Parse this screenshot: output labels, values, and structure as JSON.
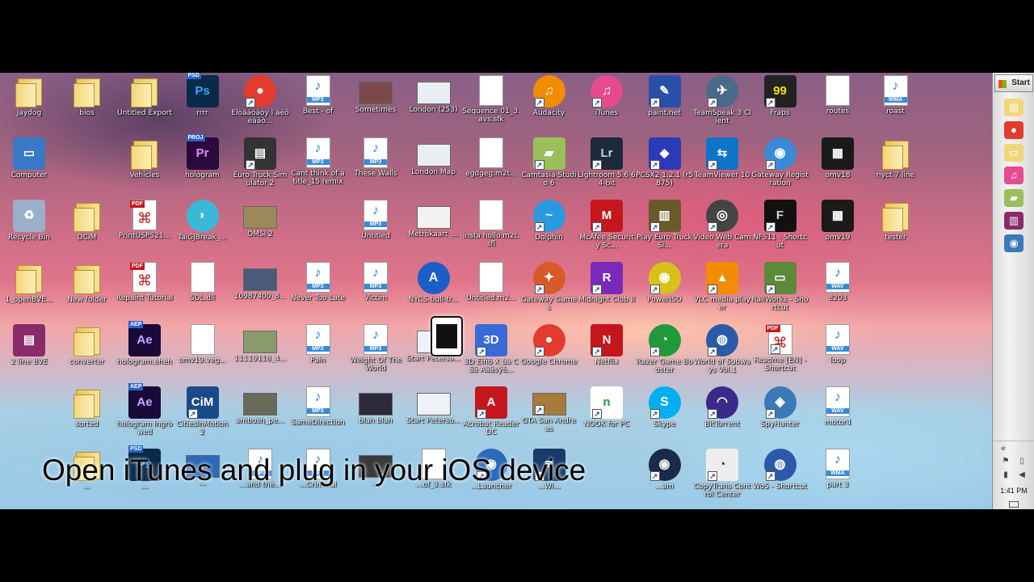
{
  "desktop": {
    "icons": [
      {
        "label": "Jaydog",
        "kind": "user",
        "color": "#e8c55a"
      },
      {
        "label": "bios",
        "kind": "folder"
      },
      {
        "label": "Untitled Export",
        "kind": "folder"
      },
      {
        "label": "rrrr",
        "kind": "app",
        "badge": "PSD",
        "text": "Ps",
        "color": "#0a2a4a",
        "fg": "#31a8ff"
      },
      {
        "label": "Élòåáòàòy l àéöeáäò...",
        "kind": "round",
        "text": "●",
        "color": "#e33b2e",
        "shortcut": true
      },
      {
        "label": "Best - of",
        "kind": "audio",
        "fmt": "MP3"
      },
      {
        "label": "Sometimes",
        "kind": "pic",
        "color": "#7a4a4a"
      },
      {
        "label": "London (253)",
        "kind": "pic",
        "color": "#e9eef3"
      },
      {
        "label": "Sequence 01_3.avs.sfk",
        "kind": "doc"
      },
      {
        "label": "Audacity",
        "kind": "round",
        "text": "♫",
        "color": "#f28c00",
        "shortcut": true
      },
      {
        "label": "iTunes",
        "kind": "round",
        "text": "♫",
        "color": "#e84a8f",
        "shortcut": true
      },
      {
        "label": "paint.net",
        "kind": "app",
        "text": "✎",
        "color": "#2a4fa8",
        "shortcut": true
      },
      {
        "label": "TeamSpeak 3 Client",
        "kind": "round",
        "text": "✈",
        "color": "#4a6a8a",
        "shortcut": true
      },
      {
        "label": "Fraps",
        "kind": "app",
        "text": "99",
        "color": "#222",
        "fg": "#f5e100",
        "shortcut": true
      },
      {
        "label": "routes",
        "kind": "doc"
      },
      {
        "label": "roast",
        "kind": "audio",
        "fmt": "WMA"
      },
      {
        "label": "Computer",
        "kind": "app",
        "text": "▭",
        "color": "#3a78c8"
      },
      {
        "label": "Vehicles",
        "kind": "folder"
      },
      {
        "label": "hologram",
        "kind": "app",
        "badge": "PROJ",
        "text": "Pr",
        "color": "#2a0a3a",
        "fg": "#e58bff"
      },
      {
        "label": "Euro Truck Simulator 2",
        "kind": "app",
        "text": "▤",
        "color": "#333",
        "shortcut": true
      },
      {
        "label": "Cant think of a title_15 remix",
        "kind": "audio",
        "fmt": "MP3"
      },
      {
        "label": "These Walls",
        "kind": "audio",
        "fmt": "MP3"
      },
      {
        "label": "London Map",
        "kind": "pic",
        "color": "#e9eef3"
      },
      {
        "label": "egdgeg.m2t...",
        "kind": "doc"
      },
      {
        "label": "Camtasia Studio 6",
        "kind": "app",
        "text": "▰",
        "color": "#9bbf5a",
        "shortcut": true
      },
      {
        "label": "Lightroom 5.6 64-bit",
        "kind": "app",
        "text": "Lr",
        "color": "#1c2a3a",
        "fg": "#b9d6f2",
        "shortcut": true
      },
      {
        "label": "PCSX2 1.2.1 (r5875)",
        "kind": "app",
        "text": "◆",
        "color": "#2a3ab8",
        "shortcut": true
      },
      {
        "label": "TeamViewer 10",
        "kind": "app",
        "text": "⇆",
        "color": "#0e74c8",
        "shortcut": true
      },
      {
        "label": "Gateway Registration",
        "kind": "round",
        "text": "◉",
        "color": "#3a8ad8",
        "shortcut": true
      },
      {
        "label": "omv18",
        "kind": "app",
        "text": "▦",
        "color": "#1a1a1a"
      },
      {
        "label": "nyct 7 line",
        "kind": "folder"
      },
      {
        "label": "Recycle Bin",
        "kind": "app",
        "text": "♻",
        "color": "#9ab0c8"
      },
      {
        "label": "DCIM",
        "kind": "folder"
      },
      {
        "label": "PrintUSPS21...",
        "kind": "pdf"
      },
      {
        "label": "TaiGJBreak_...",
        "kind": "round",
        "text": "◗",
        "color": "#3ab8d8"
      },
      {
        "label": "OMSI 2",
        "kind": "pic",
        "color": "#9a8a5a"
      },
      {
        "label": "Untitled",
        "kind": "audio",
        "fmt": "MP3"
      },
      {
        "label": "Metrokaart_...",
        "kind": "pic",
        "color": "#f2f2f2"
      },
      {
        "label": "insta hollo.m2t.sfl",
        "kind": "doc"
      },
      {
        "label": "Dolphin",
        "kind": "round",
        "text": "~",
        "color": "#2a9ae0",
        "shortcut": true
      },
      {
        "label": "McAfee Security Sc...",
        "kind": "app",
        "text": "M",
        "color": "#c4161c",
        "shortcut": true
      },
      {
        "label": "Play Euro Truck Si...",
        "kind": "app",
        "text": "▥",
        "color": "#6a5a2a",
        "shortcut": true
      },
      {
        "label": "Video Web Camera",
        "kind": "round",
        "text": "◎",
        "color": "#444",
        "shortcut": true
      },
      {
        "label": "NFS11 - Shortcut",
        "kind": "app",
        "text": "F",
        "color": "#111",
        "fg": "#d8d8d8",
        "shortcut": true
      },
      {
        "label": "omv19",
        "kind": "app",
        "text": "▦",
        "color": "#1a1a1a"
      },
      {
        "label": "tester",
        "kind": "folder"
      },
      {
        "label": "1_openBVE...",
        "kind": "folder"
      },
      {
        "label": "New folder",
        "kind": "folder"
      },
      {
        "label": "Repaint Tutorial",
        "kind": "pdf"
      },
      {
        "label": "SDL.dll",
        "kind": "doc"
      },
      {
        "label": "10987400_8...",
        "kind": "pic",
        "color": "#4a5a7a"
      },
      {
        "label": "Never Too Late",
        "kind": "audio",
        "fmt": "MP3"
      },
      {
        "label": "Victim",
        "kind": "audio",
        "fmt": "MP3"
      },
      {
        "label": "NYCS-bull-tr...",
        "kind": "round",
        "text": "A",
        "color": "#1a5fc8"
      },
      {
        "label": "Untitled.m2...",
        "kind": "doc"
      },
      {
        "label": "Gateway Games",
        "kind": "round",
        "text": "✦",
        "color": "#d85a2a",
        "shortcut": true
      },
      {
        "label": "Midnight Club II",
        "kind": "app",
        "text": "R",
        "color": "#7a2ab8",
        "shortcut": true
      },
      {
        "label": "PowerISO",
        "kind": "round",
        "text": "◉",
        "color": "#d8c21a",
        "shortcut": true
      },
      {
        "label": "VLC media player",
        "kind": "app",
        "text": "▲",
        "color": "#f28c00",
        "shortcut": true
      },
      {
        "label": "RailWorks - Shortcut",
        "kind": "app",
        "text": "▭",
        "color": "#5a8a3a",
        "shortcut": true
      },
      {
        "label": "8203",
        "kind": "audio",
        "fmt": "WAV"
      },
      {
        "label": "2 line BVE",
        "kind": "app",
        "text": "▤",
        "color": "#8a2a6a"
      },
      {
        "label": "converter",
        "kind": "folder"
      },
      {
        "label": "hologram.eheh",
        "kind": "app",
        "badge": "AEP",
        "text": "Ae",
        "color": "#1a0a3a",
        "fg": "#c9a7ff"
      },
      {
        "label": "omv19.veg...",
        "kind": "doc"
      },
      {
        "label": "11119118_4...",
        "kind": "pic",
        "color": "#8a9a6a"
      },
      {
        "label": "Pain",
        "kind": "audio",
        "fmt": "MP3"
      },
      {
        "label": "Weight Of The World",
        "kind": "audio",
        "fmt": "MP3"
      },
      {
        "label": "Start Peterso...",
        "kind": "pic",
        "color": "#eef2f6"
      },
      {
        "label": "3D Éiñõ X ùà Cãã Aàäsýõ...",
        "kind": "app",
        "text": "3D",
        "color": "#3a6ad8",
        "shortcut": true
      },
      {
        "label": "Google Chrome",
        "kind": "round",
        "text": "●",
        "color": "#e33b2e",
        "shortcut": true
      },
      {
        "label": "Netflix",
        "kind": "app",
        "text": "N",
        "color": "#c4161c",
        "shortcut": true
      },
      {
        "label": "Razer Game Booster",
        "kind": "round",
        "text": "◔",
        "color": "#1f9a3a",
        "shortcut": true
      },
      {
        "label": "World of Subways Vol.1",
        "kind": "round",
        "text": "◍",
        "color": "#2a5aa8",
        "shortcut": true
      },
      {
        "label": "Readme [EN] - Shortcut",
        "kind": "pdf",
        "shortcut": true
      },
      {
        "label": "loop",
        "kind": "audio",
        "fmt": "WAV"
      },
      {
        "label": "sorted",
        "kind": "folder"
      },
      {
        "label": "hologram ingrowed",
        "kind": "app",
        "badge": "AEP",
        "text": "Ae",
        "color": "#1a0a3a",
        "fg": "#c9a7ff"
      },
      {
        "label": "CitiesInMotion 2",
        "kind": "app",
        "text": "CiM",
        "color": "#1a4a8a",
        "shortcut": true
      },
      {
        "label": "ambush_pe...",
        "kind": "pic",
        "color": "#6a6a5a"
      },
      {
        "label": "SameDirection",
        "kind": "audio",
        "fmt": "MP3"
      },
      {
        "label": "blah blah",
        "kind": "pic",
        "color": "#2a2a3a"
      },
      {
        "label": "Start Peterso...",
        "kind": "pic",
        "color": "#eef2f6"
      },
      {
        "label": "Acrobat Reader DC",
        "kind": "app",
        "text": "A",
        "color": "#c4161c",
        "shortcut": true
      },
      {
        "label": "GTA San Andreas",
        "kind": "pic",
        "color": "#a87a3a",
        "shortcut": true
      },
      {
        "label": "NOOK for PC",
        "kind": "app",
        "text": "n",
        "color": "#fff",
        "fg": "#1a9a5a",
        "shortcut": true
      },
      {
        "label": "Skype",
        "kind": "round",
        "text": "S",
        "color": "#00aff0",
        "shortcut": true
      },
      {
        "label": "BitTorrent",
        "kind": "round",
        "text": "◠",
        "color": "#3a2a8a",
        "shortcut": true
      },
      {
        "label": "SpyHunter",
        "kind": "round",
        "text": "◈",
        "color": "#3a7ab8",
        "shortcut": true
      },
      {
        "label": "motor4",
        "kind": "audio",
        "fmt": "WAV"
      },
      {
        "label": "...",
        "kind": "folder"
      },
      {
        "label": "...",
        "kind": "app",
        "badge": "PSD",
        "text": "Ps",
        "color": "#0a2a4a",
        "fg": "#31a8ff"
      },
      {
        "label": "...",
        "kind": "pic",
        "color": "#2a6ab8"
      },
      {
        "label": "...and the...",
        "kind": "audio",
        "fmt": "MP3"
      },
      {
        "label": "...Criminal",
        "kind": "audio",
        "fmt": "MP3"
      },
      {
        "label": "...",
        "kind": "pic",
        "color": "#3a3a3a"
      },
      {
        "label": "...of_3.sfk",
        "kind": "doc"
      },
      {
        "label": "...Launcher",
        "kind": "round",
        "text": "◉",
        "color": "#2a6ab8",
        "shortcut": true
      },
      {
        "label": "...Wi...",
        "kind": "app",
        "text": "≋",
        "color": "#1a3a6a",
        "shortcut": true
      },
      {
        "label": "...am",
        "kind": "round",
        "text": "◉",
        "color": "#1a2a4a",
        "shortcut": true
      },
      {
        "label": "CopyTrans Control Center",
        "kind": "app",
        "text": "◔",
        "color": "#eee",
        "fg": "#333",
        "shortcut": true
      },
      {
        "label": "WoS - Shortcut",
        "kind": "round",
        "text": "◍",
        "color": "#2a5aa8",
        "shortcut": true
      },
      {
        "label": "part 3",
        "kind": "audio",
        "fmt": "WMA"
      }
    ]
  },
  "taskbar": {
    "start_label": "Start",
    "pinned": [
      {
        "name": "explorer-taskbar-icon",
        "symbol": "▤",
        "color": "#f2d77a"
      },
      {
        "name": "chrome-taskbar-icon",
        "symbol": "●",
        "color": "#e33b2e"
      },
      {
        "name": "folder-taskbar-icon",
        "symbol": "▭",
        "color": "#f2d77a"
      },
      {
        "name": "itunes-taskbar-icon",
        "symbol": "♫",
        "color": "#e84a8f"
      },
      {
        "name": "camtasia-taskbar-icon",
        "symbol": "▰",
        "color": "#9bbf5a"
      },
      {
        "name": "winrar-taskbar-icon",
        "symbol": "▥",
        "color": "#8a2a6a"
      },
      {
        "name": "steam-taskbar-icon",
        "symbol": "◉",
        "color": "#3a7ab8"
      }
    ],
    "tray": {
      "chevron": "«",
      "time": "1:41 PM"
    }
  },
  "overlay": {
    "caption": "Open iTunes and plug in your iOS device"
  }
}
